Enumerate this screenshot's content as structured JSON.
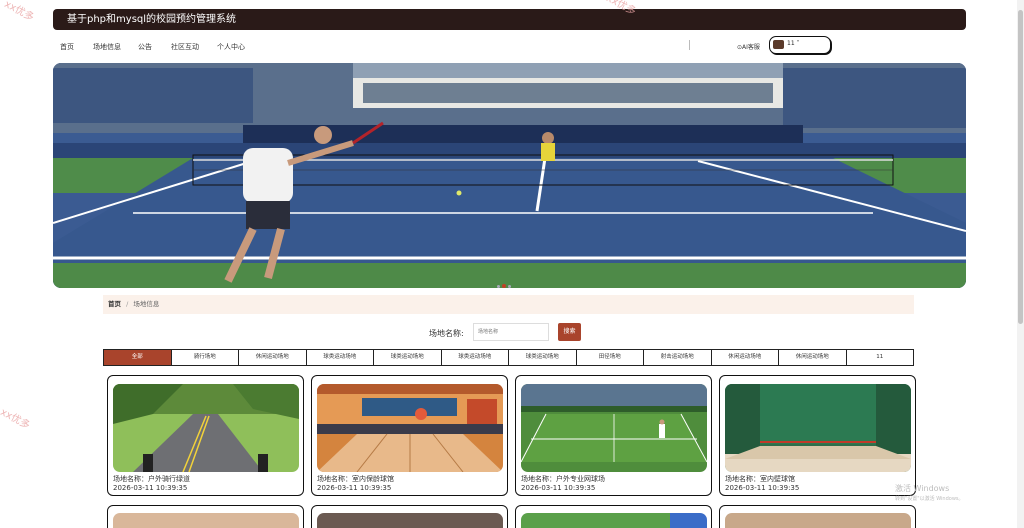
{
  "header": {
    "title": "基于php和mysql的校园预约管理系统"
  },
  "nav": {
    "items": [
      "首页",
      "场地信息",
      "公告",
      "社区互动",
      "个人中心"
    ],
    "ai_label": "⊙AI客服",
    "user_label": "11 ˅"
  },
  "breadcrumb": {
    "home": "首页",
    "sep": "/",
    "current": "场地信息"
  },
  "search": {
    "label": "场地名称:",
    "placeholder": "场地名称",
    "button": "搜索"
  },
  "tabs": [
    "全部",
    "骑行场地",
    "休闲运动场地",
    "球类运动场地",
    "球类运动场地",
    "球类运动场地",
    "球类运动场地",
    "田径场地",
    "射击运动场地",
    "休闲运动场地",
    "休闲运动场地",
    "11"
  ],
  "cards": [
    {
      "name": "场地名称：户外骑行绿道",
      "time": "2026-03-11 10:39:35",
      "icon": "cycling-path-image"
    },
    {
      "name": "场地名称：室内保龄球馆",
      "time": "2026-03-11 10:39:35",
      "icon": "bowling-alley-image"
    },
    {
      "name": "场地名称：户外专业网球场",
      "time": "2026-03-11 10:39:35",
      "icon": "tennis-court-image"
    },
    {
      "name": "场地名称：室内壁球馆",
      "time": "2026-03-11 10:39:35",
      "icon": "squash-court-image"
    }
  ],
  "watermarks": [
    "xx优多",
    "xx优多",
    "xx优多"
  ],
  "windows_activation": {
    "line1": "激活 Windows",
    "line2": "转到\"设置\"以激活 Windows。"
  },
  "colors": {
    "accent": "#a9442c",
    "header_bg": "#2a1a18",
    "breadcrumb_bg": "#fbf1ea"
  }
}
